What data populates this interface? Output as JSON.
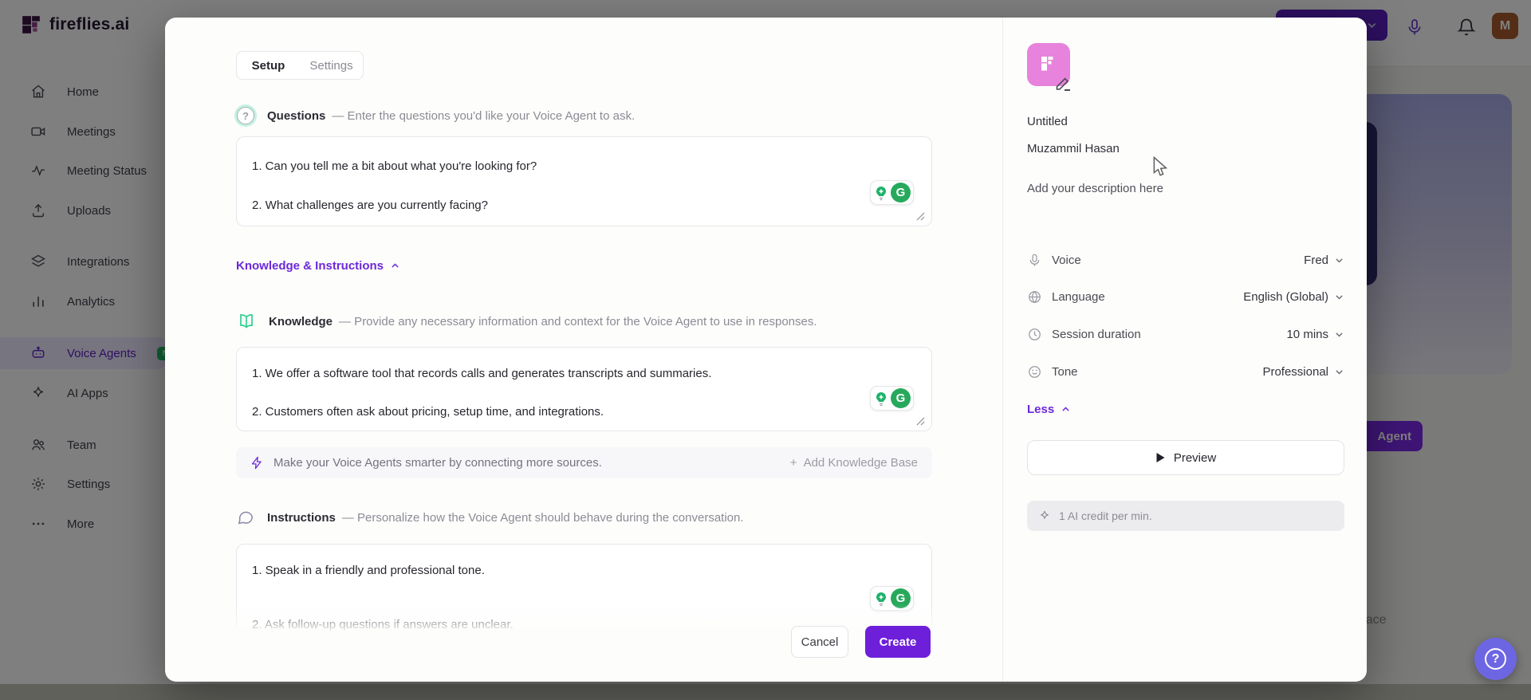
{
  "brand": {
    "logo": "fireflies.ai"
  },
  "sidebar": {
    "items": [
      {
        "label": "Home"
      },
      {
        "label": "Meetings"
      },
      {
        "label": "Meeting Status"
      },
      {
        "label": "Uploads"
      },
      {
        "label": "Integrations"
      },
      {
        "label": "Analytics"
      },
      {
        "label": "Voice Agents",
        "badge": "NEW"
      },
      {
        "label": "AI Apps"
      },
      {
        "label": "Team"
      },
      {
        "label": "Settings"
      },
      {
        "label": "More"
      }
    ]
  },
  "header": {
    "avatar_initial": "M"
  },
  "background": {
    "agent_button_label": "Agent",
    "partial_text": "rface",
    "help_label": "?"
  },
  "icons": {
    "grammarly_letter": "G",
    "plus": "+"
  },
  "modal": {
    "tabs": {
      "setup": "Setup",
      "settings": "Settings"
    },
    "questions": {
      "title": "Questions",
      "description": "— Enter the questions you'd like your Voice Agent to ask.",
      "line1": "1. Can you tell me a bit about what you're looking for?",
      "line2": "2. What challenges are you currently facing?"
    },
    "knowledge_toggle": "Knowledge & Instructions",
    "knowledge": {
      "title": "Knowledge",
      "description": "— Provide any necessary information and context for the Voice Agent to use in responses.",
      "line1": "1. We offer a software tool that records calls and generates transcripts and summaries.",
      "line2": "2. Customers often ask about pricing, setup time, and integrations."
    },
    "smarter": {
      "text": "Make your Voice Agents smarter by connecting more sources.",
      "action": "Add Knowledge Base"
    },
    "instructions": {
      "title": "Instructions",
      "description": "— Personalize how the Voice Agent should behave during the conversation.",
      "line1": "1. Speak in a friendly and professional tone.",
      "line2": "2. Ask follow-up questions if answers are unclear."
    },
    "footer": {
      "cancel": "Cancel",
      "create": "Create"
    },
    "panel": {
      "name": "Untitled",
      "owner": "Muzammil Hasan",
      "description": "Add your description here",
      "rows": [
        {
          "label": "Voice",
          "value": "Fred"
        },
        {
          "label": "Language",
          "value": "English (Global)"
        },
        {
          "label": "Session duration",
          "value": "10 mins"
        },
        {
          "label": "Tone",
          "value": "Professional"
        }
      ],
      "less": "Less",
      "preview": "Preview",
      "credit": "1 AI credit per min."
    }
  },
  "colors": {
    "accent": "#6d28d9",
    "create_button": "#6d1fd9",
    "new_badge": "#23c16b",
    "avatar_pink": "#e783dc",
    "help_button": "#6d66e2",
    "grammarly_green": "#27a95c",
    "header_avatar": "#a85a2c"
  }
}
